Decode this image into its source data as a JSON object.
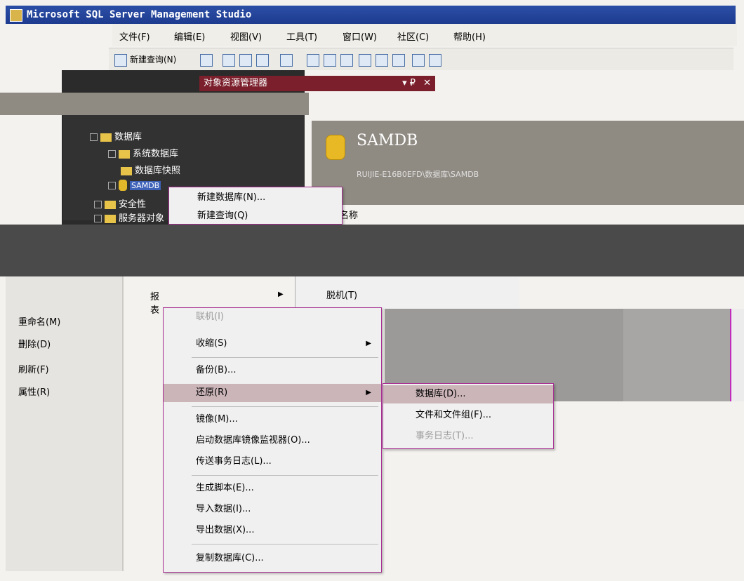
{
  "window": {
    "title": "Microsoft SQL Server Management Studio"
  },
  "menubar": [
    "文件(F)",
    "编辑(E)",
    "视图(V)",
    "工具(T)",
    "窗口(W)",
    "社区(C)",
    "帮助(H)"
  ],
  "toolbar": {
    "new_query": "新建查询(N)"
  },
  "object_explorer": {
    "title": "对象资源管理器",
    "pin": "▾ ₽",
    "close": "✕",
    "tree": {
      "databases": "数据库",
      "system_databases": "系统数据库",
      "snapshots": "数据库快照",
      "samdb": "SAMDB",
      "security": "安全性",
      "server_objects": "服务器对象"
    }
  },
  "summary": {
    "title": "SAMDB",
    "path": "RUIJIE-E16B0EFD\\数据库\\SAMDB",
    "name_col": "名称"
  },
  "context_menu_top": {
    "new_db": "新建数据库(N)...",
    "new_query": "新建查询(Q)"
  },
  "left_menu": {
    "reports": "报表",
    "rename": "重命名(M)",
    "delete": "删除(D)",
    "refresh": "刷新(F)",
    "properties": "属性(R)"
  },
  "tasks_menu": {
    "offline_header": "脱机(T)",
    "items": {
      "online": "联机(I)",
      "shrink": "收缩(S)",
      "backup": "备份(B)...",
      "restore": "还原(R)",
      "mirror": "镜像(M)...",
      "mirror_monitor": "启动数据库镜像监视器(O)...",
      "log_shipping": "传送事务日志(L)...",
      "gen_scripts": "生成脚本(E)...",
      "import": "导入数据(I)...",
      "export": "导出数据(X)...",
      "copy_db": "复制数据库(C)..."
    }
  },
  "restore_submenu": {
    "database": "数据库(D)...",
    "files": "文件和文件组(F)...",
    "trans_log": "事务日志(T)..."
  }
}
